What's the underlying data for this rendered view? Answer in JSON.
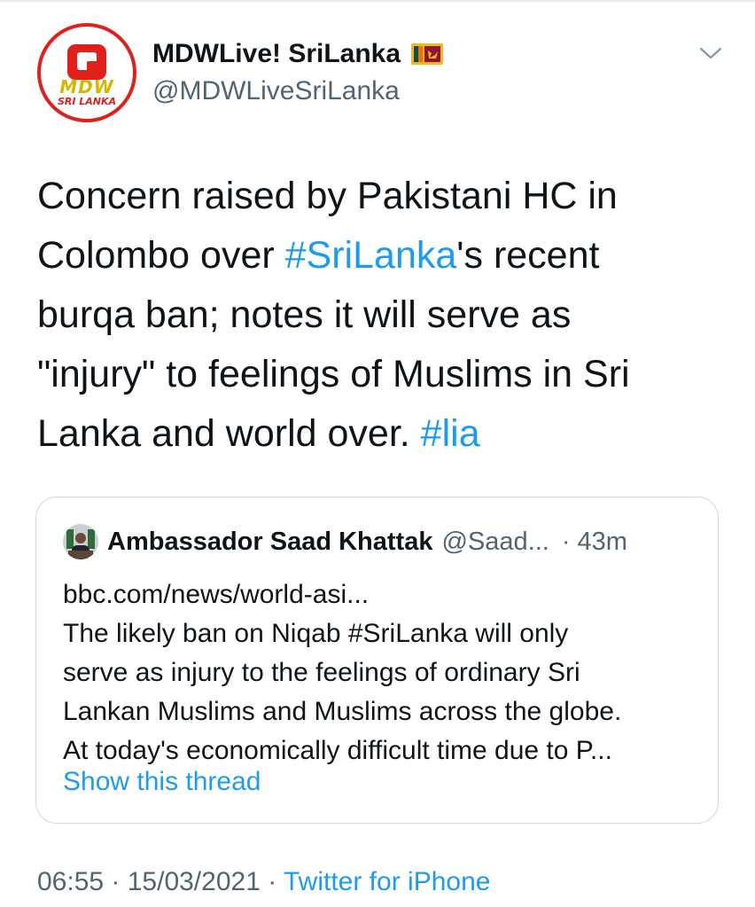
{
  "author": {
    "display_name": "MDWLive! SriLanka",
    "handle": "@MDWLiveSriLanka",
    "avatar_text": "MDW",
    "avatar_subtext": "SRI LANKA",
    "flag_icon": "sri-lanka-flag-icon"
  },
  "tweet": {
    "lines": [
      [
        {
          "text": "Concern raised by Pakistani HC in",
          "link": false
        }
      ],
      [
        {
          "text": "Colombo over ",
          "link": false
        },
        {
          "text": "#SriLanka",
          "link": true
        },
        {
          "text": "'s recent",
          "link": false
        }
      ],
      [
        {
          "text": "burqa ban; notes it will serve as",
          "link": false
        }
      ],
      [
        {
          "text": "\"injury\" to feelings of Muslims in Sri",
          "link": false
        }
      ],
      [
        {
          "text": "Lanka and world over. ",
          "link": false
        },
        {
          "text": "#lia",
          "link": true
        }
      ]
    ]
  },
  "quoted_tweet": {
    "display_name": "Ambassador Saad Khattak",
    "handle": "@Saad...",
    "time": "· 43m",
    "body_lines": [
      "bbc.com/news/world-asi...",
      "The likely ban on Niqab #SriLanka will only",
      "serve as injury to the feelings of ordinary Sri",
      "Lankan Muslims and Muslims across the globe.",
      "At today's economically difficult time due to P..."
    ],
    "show_thread": "Show this thread"
  },
  "meta": {
    "time": "06:55 · 15/03/2021 · ",
    "source": "Twitter for iPhone"
  },
  "colors": {
    "link": "#1d9bf0",
    "secondary_text": "#536471",
    "border": "#cfd9de",
    "brand_red": "#e0201b"
  }
}
